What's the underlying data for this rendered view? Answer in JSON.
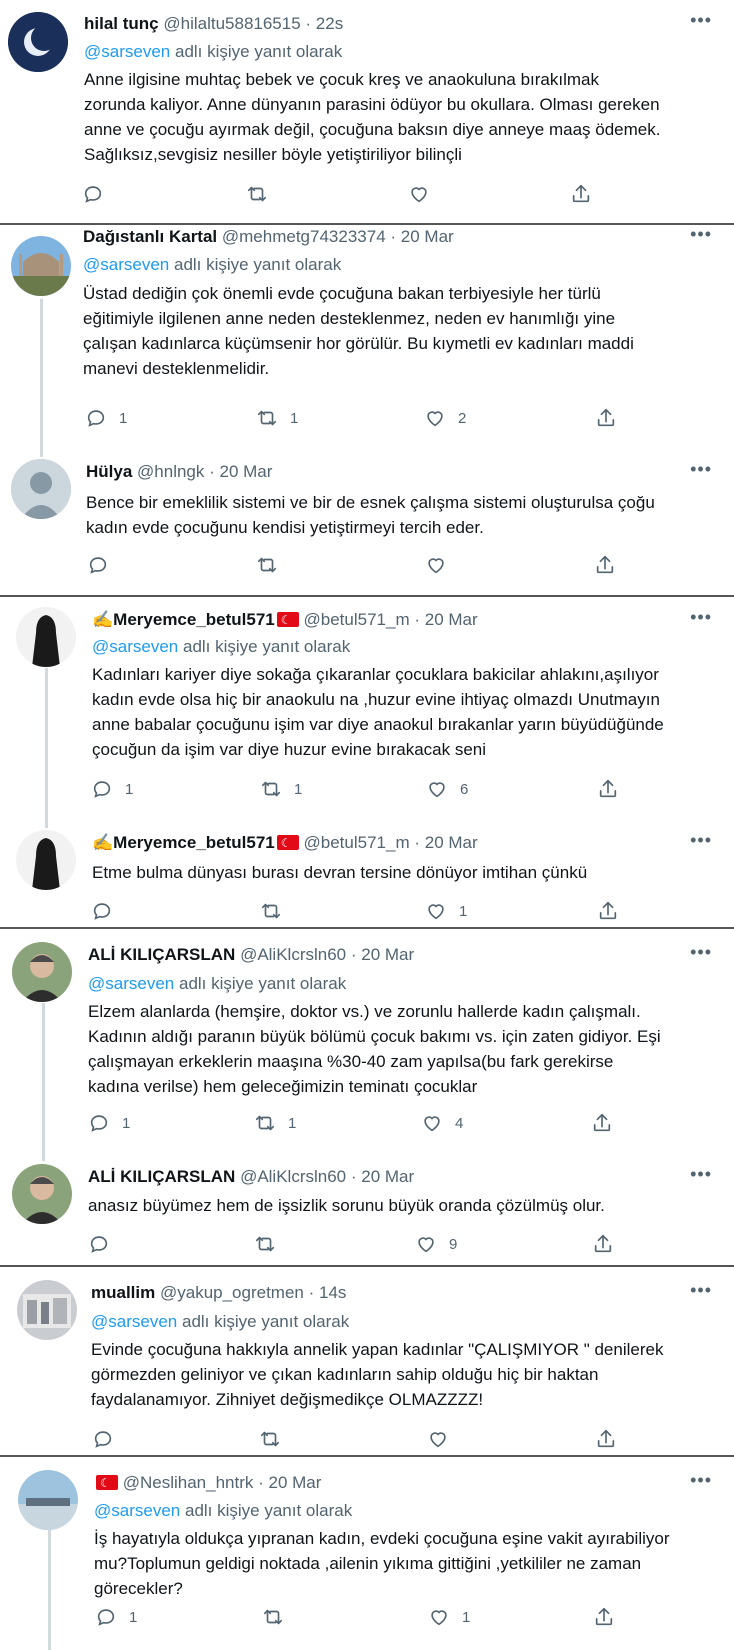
{
  "reply_prefix": "adlı kişiye yanıt olarak",
  "mention": "@sarseven",
  "tweets": [
    {
      "name": "hilal tunç",
      "handle": "@hilaltu58816515",
      "time": "22s",
      "lines": [
        "Anne ilgisine muhtaç bebek ve çocuk kreş ve anaokuluna bırakılmak",
        "zorunda kaliyor. Anne dünyanın parasini ödüyor bu okullara. Olması gereken",
        "anne ve çocuğu ayırmak değil, çocuğuna baksın diye anneye maaş ödemek.",
        "Sağlıksız,sevgisiz nesiller böyle yetiştiriliyor bilinçli"
      ],
      "reply": "",
      "retweet": "",
      "like": ""
    },
    {
      "name": "Dağıstanlı Kartal",
      "handle": "@mehmetg74323374",
      "time": "20 Mar",
      "lines": [
        "Üstad dediğin çok önemli evde çocuğuna bakan terbiyesiyle her türlü",
        "eğitimiyle ilgilenen anne neden desteklenmez, neden  ev hanımlığı yine",
        "çalışan kadınlarca küçümsenir hor görülür. Bu kıymetli ev kadınları maddi",
        "manevi desteklenmelidir."
      ],
      "reply": "1",
      "retweet": "1",
      "like": "2"
    },
    {
      "name": "Hülya",
      "handle": "@hnlngk",
      "time": "20 Mar",
      "lines": [
        "Bence bir emeklilik sistemi ve bir de esnek çalışma sistemi oluşturulsa çoğu",
        "kadın evde çocuğunu kendisi yetiştirmeyi tercih eder."
      ],
      "reply": "",
      "retweet": "",
      "like": ""
    },
    {
      "name": "Meryemce_betul571",
      "handle": "@betul571_m",
      "time": "20 Mar",
      "lines": [
        "Kadınları kariyer diye sokağa çıkaranlar çocuklara bakicilar ahlakını,aşılıyor",
        "kadın evde olsa hiç bir anaokulu na ,huzur evine ihtiyaç olmazdı Unutmayın",
        "anne babalar çocuğunu işim var diye anaokul bırakanlar yarın büyüdüğünde",
        "çocuğun da işim var diye huzur evine bırakacak seni"
      ],
      "reply": "1",
      "retweet": "1",
      "like": "6"
    },
    {
      "name": "Meryemce_betul571",
      "handle": "@betul571_m",
      "time": "20 Mar",
      "lines": [
        "Etme bulma dünyası burası devran tersine dönüyor imtihan çünkü"
      ],
      "reply": "",
      "retweet": "",
      "like": "1"
    },
    {
      "name": "ALİ KILIÇARSLAN",
      "handle": "@AliKlcrsln60",
      "time": "20 Mar",
      "lines": [
        "Elzem alanlarda (hemşire, doktor vs.) ve zorunlu hallerde kadın çalışmalı.",
        "Kadının aldığı paranın büyük bölümü çocuk bakımı vs. için zaten gidiyor. Eşi",
        "çalışmayan erkeklerin maaşına %30-40 zam yapılsa(bu fark gerekirse",
        "kadına verilse) hem geleceğimizin teminatı çocuklar"
      ],
      "reply": "1",
      "retweet": "1",
      "like": "4"
    },
    {
      "name": "ALİ KILIÇARSLAN",
      "handle": "@AliKlcrsln60",
      "time": "20 Mar",
      "lines": [
        "anasız büyümez hem de işsizlik sorunu büyük oranda çözülmüş olur."
      ],
      "reply": "",
      "retweet": "",
      "like": "9"
    },
    {
      "name": "muallim",
      "handle": "@yakup_ogretmen",
      "time": "14s",
      "lines": [
        "Evinde çocuğuna hakkıyla annelik yapan kadınlar \"ÇALIŞMIYOR \" denilerek",
        "görmezden geliniyor ve çıkan kadınların sahip olduğu hiç bir haktan",
        "faydalanamıyor. Zihniyet değişmedikçe OLMAZZZZ!"
      ],
      "reply": "",
      "retweet": "",
      "like": ""
    },
    {
      "name": "",
      "handle": "@Neslihan_hntrk",
      "time": "20 Mar",
      "lines": [
        "İş hayatıyla oldukça yıpranan kadın, evdeki çocuğuna eşine vakit ayırabiliyor",
        "mu?Toplumun geldigi noktada ,ailenin yıkıma gittiğini ,yetkililer ne zaman",
        "görecekler?"
      ],
      "reply": "1",
      "retweet": "",
      "like": "1"
    }
  ]
}
